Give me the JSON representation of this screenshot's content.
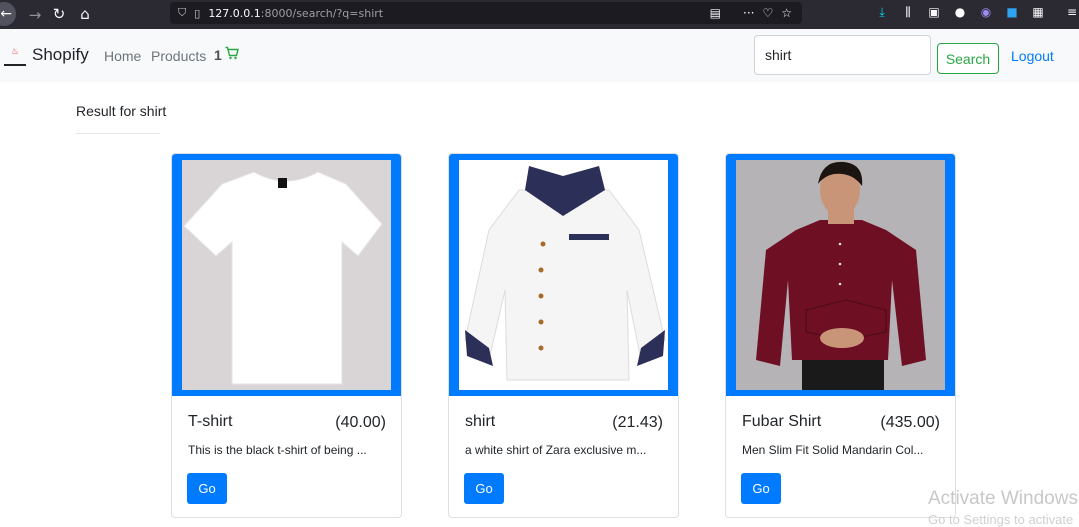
{
  "browser": {
    "url_host": "127.0.0.1",
    "url_rest": ":8000/search/?q=shirt"
  },
  "navbar": {
    "brand": "Shopify",
    "links": [
      "Home",
      "Products"
    ],
    "cart_count": "1",
    "search_value": "shirt",
    "search_button": "Search",
    "logout": "Logout"
  },
  "results": {
    "title": "Result for shirt"
  },
  "products": [
    {
      "name": "T-shirt",
      "price": "(40.00)",
      "desc": "This is the black t-shirt of being ...",
      "button": "Go"
    },
    {
      "name": "shirt",
      "price": "(21.43)",
      "desc": "a white shirt of Zara exclusive m...",
      "button": "Go"
    },
    {
      "name": "Fubar Shirt",
      "price": "(435.00)",
      "desc": "Men Slim Fit Solid Mandarin Col...",
      "button": "Go"
    }
  ],
  "os": {
    "watermark": "Activate Windows",
    "watermark_sub": "Go to Settings to activate"
  },
  "colors": {
    "primary": "#007bff",
    "success": "#28a745",
    "navbar_bg": "#f8f9fa",
    "browser_bg": "#2b2a33"
  }
}
